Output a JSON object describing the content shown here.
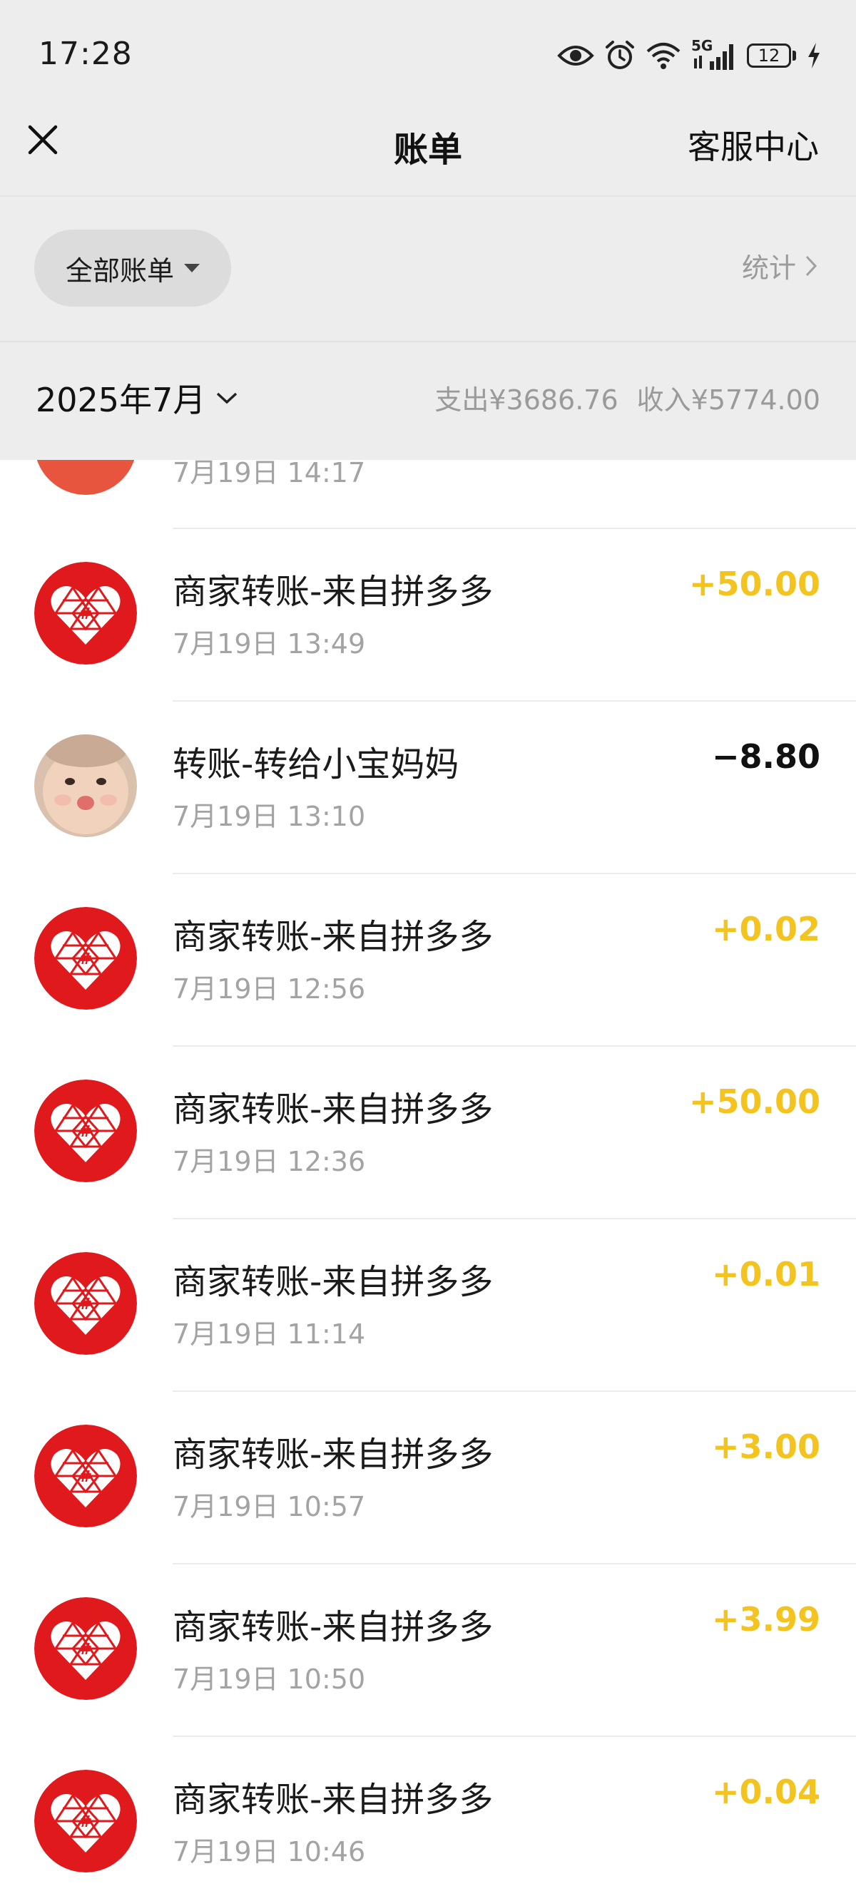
{
  "status_bar": {
    "time": "17:28",
    "network": "5G",
    "battery": "12",
    "icons": [
      "eye-icon",
      "alarm-icon",
      "wifi-icon",
      "signal-icon",
      "battery-icon",
      "charging-icon"
    ]
  },
  "nav": {
    "title": "账单",
    "right_label": "客服中心",
    "close_icon": "close-icon"
  },
  "filter": {
    "label": "全部账单",
    "stats_label": "统计"
  },
  "month_header": {
    "month": "2025年7月",
    "expense": "支出¥3686.76",
    "income": "收入¥5774.00"
  },
  "colors": {
    "income": "#f3c31f",
    "expense": "#111111",
    "pdd_red": "#e0191c"
  },
  "partial_item": {
    "time": "7月19日 14:17"
  },
  "transactions": [
    {
      "title": "商家转账-来自拼多多",
      "time": "7月19日 13:49",
      "amount": "+50.00",
      "type": "income",
      "avatar": "pinduoduo-logo"
    },
    {
      "title": "转账-转给小宝妈妈",
      "time": "7月19日 13:10",
      "amount": "−8.80",
      "type": "expense",
      "avatar": "baby-photo"
    },
    {
      "title": "商家转账-来自拼多多",
      "time": "7月19日 12:56",
      "amount": "+0.02",
      "type": "income",
      "avatar": "pinduoduo-logo"
    },
    {
      "title": "商家转账-来自拼多多",
      "time": "7月19日 12:36",
      "amount": "+50.00",
      "type": "income",
      "avatar": "pinduoduo-logo"
    },
    {
      "title": "商家转账-来自拼多多",
      "time": "7月19日 11:14",
      "amount": "+0.01",
      "type": "income",
      "avatar": "pinduoduo-logo"
    },
    {
      "title": "商家转账-来自拼多多",
      "time": "7月19日 10:57",
      "amount": "+3.00",
      "type": "income",
      "avatar": "pinduoduo-logo"
    },
    {
      "title": "商家转账-来自拼多多",
      "time": "7月19日 10:50",
      "amount": "+3.99",
      "type": "income",
      "avatar": "pinduoduo-logo"
    },
    {
      "title": "商家转账-来自拼多多",
      "time": "7月19日 10:46",
      "amount": "+0.04",
      "type": "income",
      "avatar": "pinduoduo-logo"
    }
  ]
}
